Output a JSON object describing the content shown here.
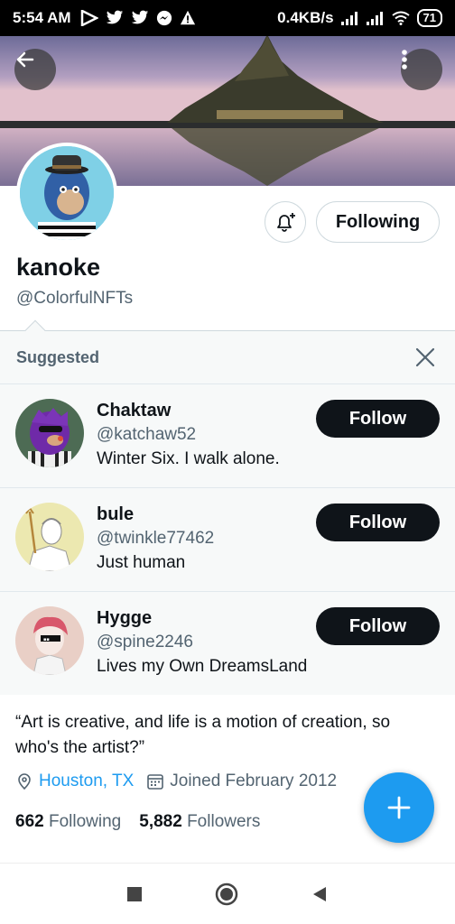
{
  "status_bar": {
    "time": "5:54 AM",
    "network_speed": "0.4KB/s",
    "battery": "71",
    "icons": [
      "play-icon",
      "twitter-icon",
      "twitter-icon",
      "messenger-icon",
      "warning-icon",
      "signal-icon",
      "signal-icon",
      "wifi-icon",
      "battery-icon"
    ]
  },
  "profile": {
    "display_name": "kanoke",
    "handle": "@ColorfulNFTs",
    "following_button": "Following",
    "bio": "“Art is creative, and life is a motion of creation, so who's the artist?”",
    "location": "Houston, TX",
    "joined": "Joined February 2012",
    "following_count": "662",
    "following_label": "Following",
    "followers_count": "5,882",
    "followers_label": "Followers"
  },
  "suggested": {
    "title": "Suggested",
    "users": [
      {
        "name": "Chaktaw",
        "handle": "@katchaw52",
        "bio": "Winter Six. I walk alone.",
        "button": "Follow"
      },
      {
        "name": "bule",
        "handle": "@twinkle77462",
        "bio": "Just human",
        "button": "Follow"
      },
      {
        "name": "Hygge",
        "handle": "@spine2246",
        "bio": "Lives my Own DreamsLand",
        "button": "Follow"
      }
    ]
  },
  "colors": {
    "accent": "#1d9bf0",
    "text": "#0f1419",
    "secondary": "#536471"
  }
}
